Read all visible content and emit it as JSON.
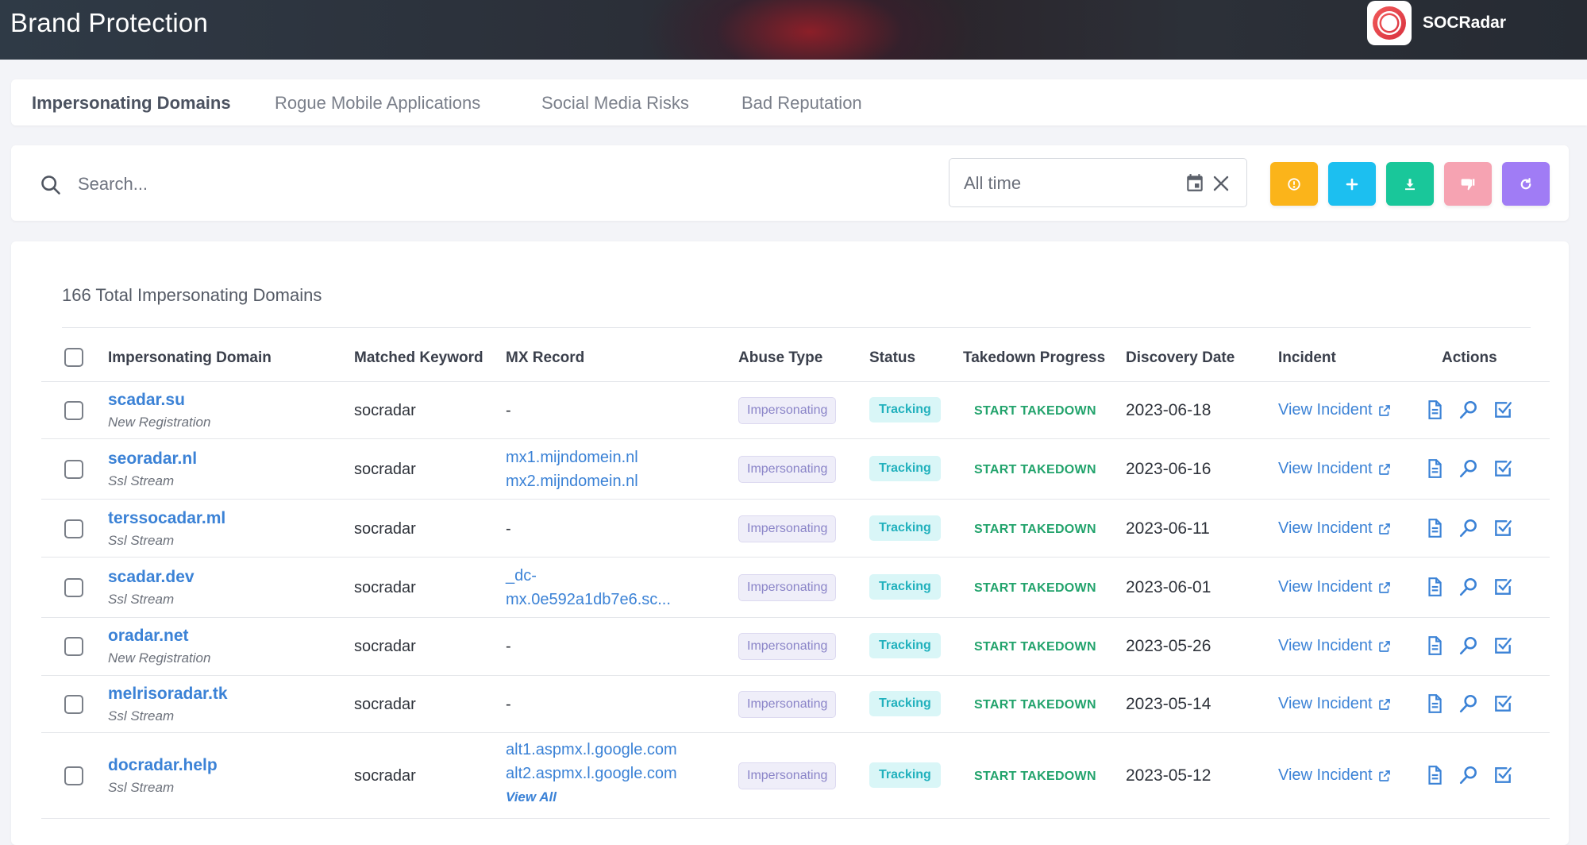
{
  "header": {
    "title": "Brand Protection",
    "brand_name": "SOCRadar"
  },
  "tabs": [
    {
      "label": "Impersonating Domains",
      "active": true
    },
    {
      "label": "Rogue Mobile Applications",
      "active": false
    },
    {
      "label": "Social Media Risks",
      "active": false
    },
    {
      "label": "Bad Reputation",
      "active": false
    }
  ],
  "search": {
    "placeholder": "Search...",
    "value": ""
  },
  "date_filter": {
    "value": "All time"
  },
  "action_buttons": [
    {
      "name": "info-button",
      "icon": "info-icon",
      "color": "#fbb41a"
    },
    {
      "name": "add-button",
      "icon": "plus-icon",
      "color": "#1cbff0"
    },
    {
      "name": "download-button",
      "icon": "download-icon",
      "color": "#19c79a"
    },
    {
      "name": "dislike-button",
      "icon": "thumbs-down-icon",
      "color": "#f6a3b2"
    },
    {
      "name": "refresh-button",
      "icon": "refresh-icon",
      "color": "#a07cf5"
    }
  ],
  "table": {
    "total_label": "166 Total Impersonating Domains",
    "columns": [
      "Impersonating Domain",
      "Matched Keyword",
      "MX Record",
      "Abuse Type",
      "Status",
      "Takedown Progress",
      "Discovery Date",
      "Incident",
      "Actions"
    ],
    "rows": [
      {
        "domain": "scadar.su",
        "source": "New Registration",
        "keyword": "socradar",
        "mx": [
          "-"
        ],
        "mx_link": false,
        "abuse": "Impersonating",
        "status": "Tracking",
        "takedown": "START TAKEDOWN",
        "date": "2023-06-18",
        "incident": "View Incident"
      },
      {
        "domain": "seoradar.nl",
        "source": "Ssl Stream",
        "keyword": "socradar",
        "mx": [
          "mx1.mijndomein.nl",
          "mx2.mijndomein.nl"
        ],
        "mx_link": true,
        "abuse": "Impersonating",
        "status": "Tracking",
        "takedown": "START TAKEDOWN",
        "date": "2023-06-16",
        "incident": "View Incident"
      },
      {
        "domain": "terssocadar.ml",
        "source": "Ssl Stream",
        "keyword": "socradar",
        "mx": [
          "-"
        ],
        "mx_link": false,
        "abuse": "Impersonating",
        "status": "Tracking",
        "takedown": "START TAKEDOWN",
        "date": "2023-06-11",
        "incident": "View Incident"
      },
      {
        "domain": "scadar.dev",
        "source": "Ssl Stream",
        "keyword": "socradar",
        "mx": [
          "_dc-",
          "mx.0e592a1db7e6.sc..."
        ],
        "mx_link": true,
        "abuse": "Impersonating",
        "status": "Tracking",
        "takedown": "START TAKEDOWN",
        "date": "2023-06-01",
        "incident": "View Incident"
      },
      {
        "domain": "oradar.net",
        "source": "New Registration",
        "keyword": "socradar",
        "mx": [
          "-"
        ],
        "mx_link": false,
        "abuse": "Impersonating",
        "status": "Tracking",
        "takedown": "START TAKEDOWN",
        "date": "2023-05-26",
        "incident": "View Incident"
      },
      {
        "domain": "melrisoradar.tk",
        "source": "Ssl Stream",
        "keyword": "socradar",
        "mx": [
          "-"
        ],
        "mx_link": false,
        "abuse": "Impersonating",
        "status": "Tracking",
        "takedown": "START TAKEDOWN",
        "date": "2023-05-14",
        "incident": "View Incident"
      },
      {
        "domain": "docradar.help",
        "source": "Ssl Stream",
        "keyword": "socradar",
        "mx": [
          "alt1.aspmx.l.google.com",
          "alt2.aspmx.l.google.com"
        ],
        "mx_link": true,
        "mx_view_all": "View All",
        "abuse": "Impersonating",
        "status": "Tracking",
        "takedown": "START TAKEDOWN",
        "date": "2023-05-12",
        "incident": "View Incident"
      }
    ]
  }
}
